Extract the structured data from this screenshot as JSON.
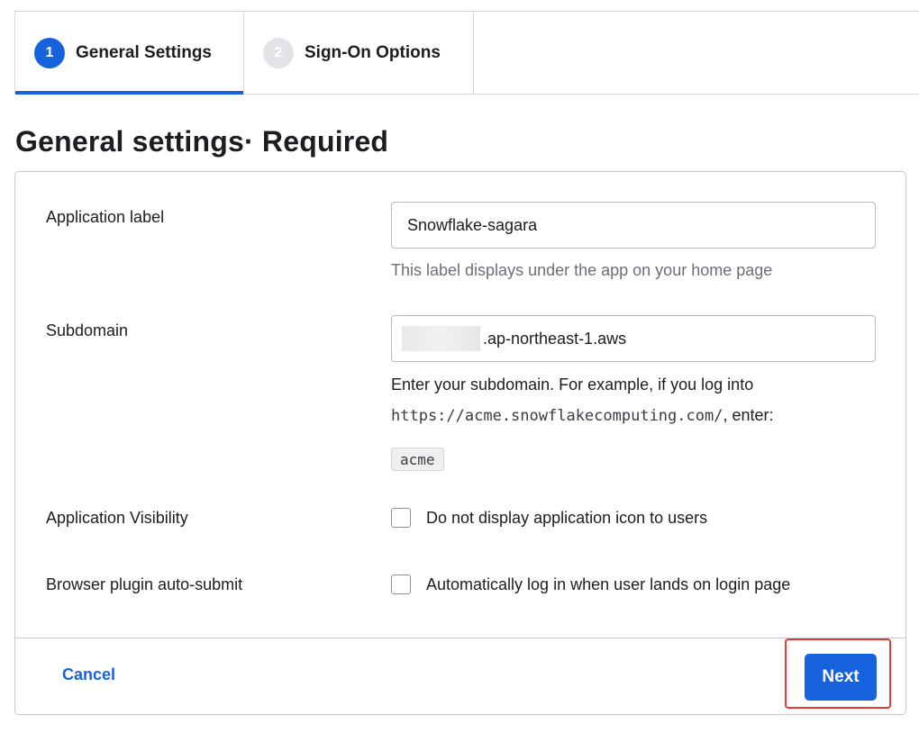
{
  "steps": [
    {
      "number": "1",
      "label": "General Settings",
      "state": "active"
    },
    {
      "number": "2",
      "label": "Sign-On Options",
      "state": "inactive"
    }
  ],
  "heading": "General settings· Required",
  "form": {
    "app_label": {
      "label": "Application label",
      "value": "Snowflake-sagara",
      "help": "This label displays under the app on your home page"
    },
    "subdomain": {
      "label": "Subdomain",
      "value_suffix": ".ap-northeast-1.aws",
      "help_prefix": "Enter your subdomain. For example, if you log into",
      "help_url": "https://acme.snowflakecomputing.com/",
      "help_suffix": ", enter:",
      "example": "acme"
    },
    "visibility": {
      "label": "Application Visibility",
      "checkbox_label": "Do not display application icon to users",
      "checked": false
    },
    "auto_submit": {
      "label": "Browser plugin auto-submit",
      "checkbox_label": "Automatically log in when user lands on login page",
      "checked": false
    }
  },
  "footer": {
    "cancel_label": "Cancel",
    "next_label": "Next"
  },
  "colors": {
    "accent": "#1662dd",
    "highlight": "#e53935"
  }
}
